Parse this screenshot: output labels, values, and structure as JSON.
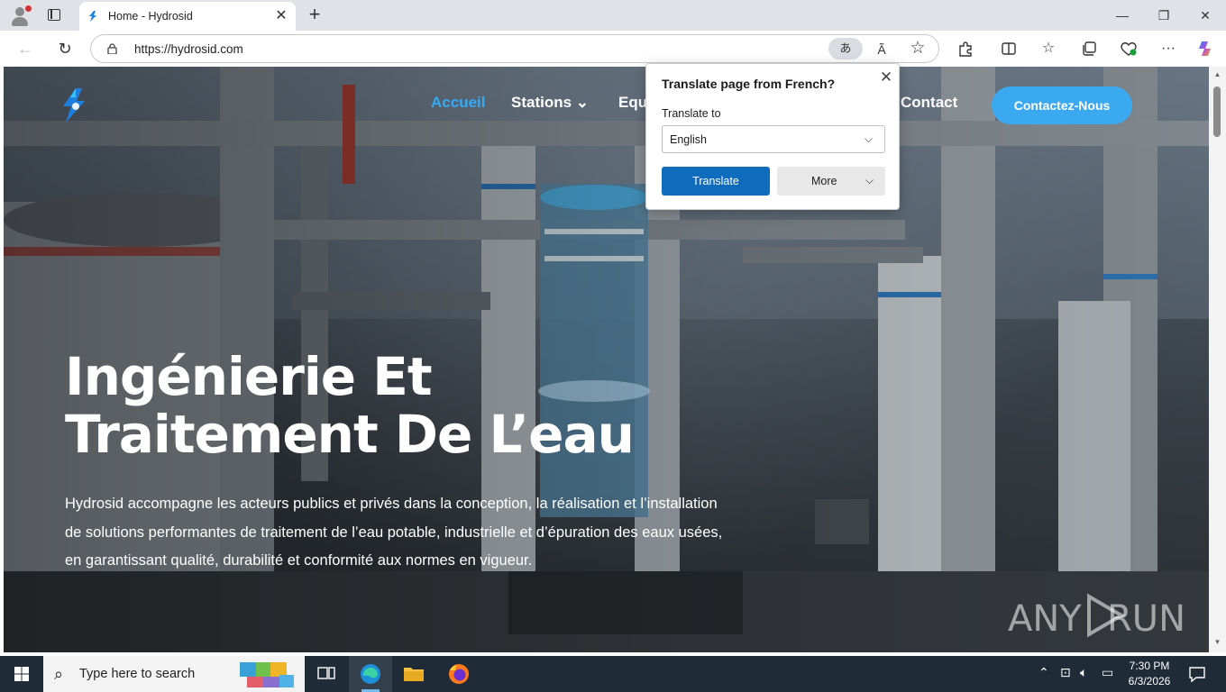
{
  "browser": {
    "tab_title": "Home - Hydrosid",
    "tab_close": "✕",
    "new_tab": "+",
    "url": "https://hydrosid.com",
    "translate_badge": "あ",
    "read_aloud": "Ã",
    "window_controls": {
      "minimize": "—",
      "restore": "❐",
      "close": "✕"
    }
  },
  "site": {
    "nav": {
      "home": "Accueil",
      "stations": "Stations ⌄",
      "equip": "Equ",
      "contact": "Contact"
    },
    "cta": "Contactez-Nous",
    "hero": {
      "title_line1": "Ingénierie Et",
      "title_line2": "Traitement De L’eau",
      "text": "Hydrosid accompagne les acteurs publics et privés dans la conception, la réalisation et l’installation de solutions performantes de traitement de l’eau potable, industrielle et d’épuration des eaux usées, en garantissant qualité, durabilité et conformité aux normes en vigueur."
    },
    "watermark": {
      "left": "ANY",
      "right": "RUN"
    }
  },
  "translate_popup": {
    "title": "Translate page from French?",
    "close": "✕",
    "label": "Translate to",
    "selected_language": "English",
    "translate_button": "Translate",
    "more_button": "More"
  },
  "taskbar": {
    "search_placeholder": "Type here to search",
    "time": "7:30 PM",
    "date": "6/3/2026"
  },
  "colors": {
    "accent": "#3aa9f0",
    "nav_active": "#35aaf5",
    "translate_primary": "#0f6cbd",
    "taskbar": "#1f2b36"
  }
}
